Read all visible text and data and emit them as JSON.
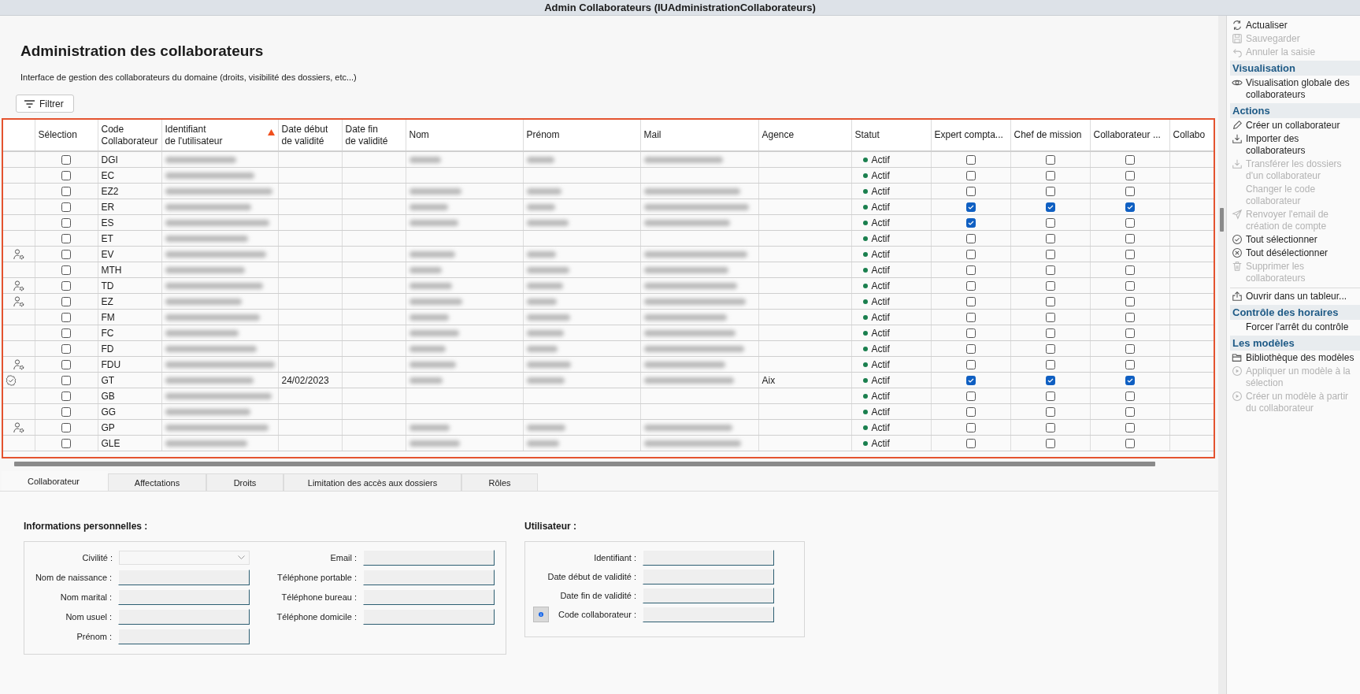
{
  "window": {
    "title": "Admin Collaborateurs (IUAdministrationCollaborateurs)"
  },
  "page": {
    "title": "Administration des collaborateurs",
    "subtitle": "Interface de gestion des collaborateurs du domaine (droits, visibilité des dossiers, etc...)",
    "filter_button": "Filtrer"
  },
  "table": {
    "focused": true,
    "columns": [
      {
        "label": "Sélection",
        "sorted": false
      },
      {
        "label": "Code\nCollaborateur",
        "sorted": false
      },
      {
        "label": "Identifiant\nde l'utilisateur",
        "sorted": true
      },
      {
        "label": "Date début\nde validité",
        "sorted": false
      },
      {
        "label": "Date fin\nde validité",
        "sorted": false
      },
      {
        "label": "Nom",
        "sorted": false
      },
      {
        "label": "Prénom",
        "sorted": false
      },
      {
        "label": "Mail",
        "sorted": false
      },
      {
        "label": "Agence",
        "sorted": false
      },
      {
        "label": "Statut",
        "sorted": false
      },
      {
        "label": "Expert compta...",
        "sorted": false
      },
      {
        "label": "Chef de mission",
        "sorted": false
      },
      {
        "label": "Collaborateur ...",
        "sorted": false
      },
      {
        "label": "Collabo",
        "sorted": false
      }
    ],
    "rows": [
      {
        "code": "DGI",
        "selected": false,
        "masked": true,
        "status": "Actif",
        "color": "#1a7f4e",
        "expert": false,
        "chef": false,
        "collab": false
      },
      {
        "code": "EC",
        "selected": false,
        "masked": false,
        "status": "Actif",
        "color": "#1a7f4e",
        "expert": false,
        "chef": false,
        "collab": false
      },
      {
        "code": "EZ2",
        "selected": false,
        "masked": true,
        "status": "Actif",
        "color": "#1a7f4e",
        "expert": false,
        "chef": false,
        "collab": false
      },
      {
        "code": "ER",
        "selected": false,
        "masked": true,
        "status": "Actif",
        "color": "#1a7f4e",
        "expert": true,
        "chef": true,
        "collab": true
      },
      {
        "code": "ES",
        "selected": false,
        "masked": true,
        "status": "Actif",
        "color": "#1a7f4e",
        "expert": true,
        "chef": false,
        "collab": false
      },
      {
        "code": "ET",
        "selected": false,
        "masked": false,
        "status": "Actif",
        "color": "#1a7f4e",
        "expert": false,
        "chef": false,
        "collab": false
      },
      {
        "kind": "user",
        "code": "EV",
        "selected": false,
        "masked": true,
        "status": "Actif",
        "color": "#1a7f4e",
        "expert": false,
        "chef": false,
        "collab": false
      },
      {
        "code": "MTH",
        "selected": false,
        "masked": true,
        "status": "Actif",
        "color": "#1a7f4e",
        "expert": false,
        "chef": false,
        "collab": false
      },
      {
        "kind": "user",
        "code": "TD",
        "selected": false,
        "masked": true,
        "status": "Actif",
        "color": "#1a7f4e",
        "expert": false,
        "chef": false,
        "collab": false
      },
      {
        "kind": "user",
        "code": "EZ",
        "selected": false,
        "masked": true,
        "status": "Actif",
        "color": "#1a7f4e",
        "expert": false,
        "chef": false,
        "collab": false
      },
      {
        "code": "FM",
        "selected": false,
        "masked": true,
        "status": "Actif",
        "color": "#1a7f4e",
        "expert": false,
        "chef": false,
        "collab": false
      },
      {
        "code": "FC",
        "selected": false,
        "masked": true,
        "status": "Actif",
        "color": "#1a7f4e",
        "expert": false,
        "chef": false,
        "collab": false
      },
      {
        "code": "FD",
        "selected": false,
        "masked": true,
        "status": "Actif",
        "color": "#1a7f4e",
        "expert": false,
        "chef": false,
        "collab": false
      },
      {
        "kind": "user",
        "code": "FDU",
        "selected": false,
        "masked": true,
        "status": "Actif",
        "color": "#1a7f4e",
        "expert": false,
        "chef": false,
        "collab": false
      },
      {
        "kind": "validated",
        "code": "GT",
        "selected": false,
        "date_debut": "24/02/2023",
        "agence": "Aix",
        "masked": true,
        "status": "Actif",
        "color": "#1a7f4e",
        "expert": true,
        "chef": true,
        "collab": true
      },
      {
        "code": "GB",
        "selected": false,
        "masked": false,
        "status": "Actif",
        "color": "#1a7f4e",
        "expert": false,
        "chef": false,
        "collab": false
      },
      {
        "code": "GG",
        "selected": false,
        "masked": false,
        "status": "Actif",
        "color": "#1a7f4e",
        "expert": false,
        "chef": false,
        "collab": false
      },
      {
        "kind": "user",
        "code": "GP",
        "selected": false,
        "masked": true,
        "status": "Actif",
        "color": "#1a7f4e",
        "expert": false,
        "chef": false,
        "collab": false
      },
      {
        "code": "GLE",
        "selected": false,
        "masked": true,
        "status": "Actif",
        "color": "#1a7f4e",
        "expert": false,
        "chef": false,
        "collab": false
      }
    ]
  },
  "tabs": [
    {
      "label": "Collaborateur",
      "selected": true
    },
    {
      "label": "Affectations",
      "selected": false
    },
    {
      "label": "Droits",
      "selected": false
    },
    {
      "label": "Limitation des accès aux dossiers",
      "selected": false
    },
    {
      "label": "Rôles",
      "selected": false
    }
  ],
  "personal_info": {
    "title": "Informations personnelles :",
    "left_fields": [
      {
        "label": "Civilité :",
        "kind": "select"
      },
      {
        "label": "Nom de naissance :",
        "kind": "text"
      },
      {
        "label": "Nom marital :",
        "kind": "text"
      },
      {
        "label": "Nom usuel :",
        "kind": "text"
      },
      {
        "label": "Prénom :",
        "kind": "text"
      }
    ],
    "right_fields": [
      {
        "label": "Email :",
        "kind": "text"
      },
      {
        "label": "Téléphone portable :",
        "kind": "text"
      },
      {
        "label": "Téléphone bureau :",
        "kind": "text"
      },
      {
        "label": "Téléphone domicile :",
        "kind": "text"
      }
    ]
  },
  "user_info": {
    "title": "Utilisateur :",
    "fields": [
      {
        "label": "Identifiant :",
        "kind": "text"
      },
      {
        "label": "Date début de validité :",
        "kind": "text"
      },
      {
        "label": "Date fin de validité :",
        "kind": "text"
      },
      {
        "label": "Code collaborateur :",
        "kind": "info"
      }
    ]
  },
  "action_pane": {
    "sections": [
      {
        "items": [
          {
            "label": "Actualiser",
            "kind": "refresh",
            "disabled": false
          },
          {
            "label": "Sauvegarder",
            "kind": "save",
            "disabled": true
          },
          {
            "label": "Annuler la saisie",
            "kind": "undo",
            "disabled": true
          }
        ]
      },
      {
        "title": "Visualisation",
        "items": [
          {
            "label": "Visualisation globale des collaborateurs",
            "kind": "eye",
            "disabled": false
          }
        ]
      },
      {
        "title": "Actions",
        "items": [
          {
            "label": "Créer un collaborateur",
            "kind": "pencil",
            "disabled": false
          },
          {
            "label": "Importer des collaborateurs",
            "kind": "import",
            "disabled": false
          },
          {
            "label": "Transférer les dossiers d'un collaborateur",
            "kind": "import",
            "disabled": true
          },
          {
            "label": "Changer le code collaborateur",
            "kind": "none",
            "disabled": true
          },
          {
            "label": "Renvoyer l'email de création de compte",
            "kind": "send",
            "disabled": true
          },
          {
            "label": "Tout sélectionner",
            "kind": "check",
            "disabled": false
          },
          {
            "label": "Tout désélectionner",
            "kind": "cross",
            "disabled": false
          },
          {
            "label": "Supprimer les collaborateurs",
            "kind": "trash",
            "disabled": true
          },
          {
            "label": "Ouvrir dans un tableur...",
            "kind": "export",
            "disabled": false,
            "divider_above": true
          }
        ]
      },
      {
        "title": "Contrôle des horaires",
        "items": [
          {
            "label": "Forcer l'arrêt du contrôle",
            "kind": "none",
            "disabled": false
          }
        ]
      },
      {
        "title": "Les modèles",
        "items": [
          {
            "label": "Bibliothèque des modèles",
            "kind": "folder",
            "disabled": false
          },
          {
            "label": "Appliquer un modèle à la sélection",
            "kind": "play",
            "disabled": true
          },
          {
            "label": "Créer un modèle à partir du collaborateur",
            "kind": "play",
            "disabled": true
          }
        ]
      }
    ]
  }
}
